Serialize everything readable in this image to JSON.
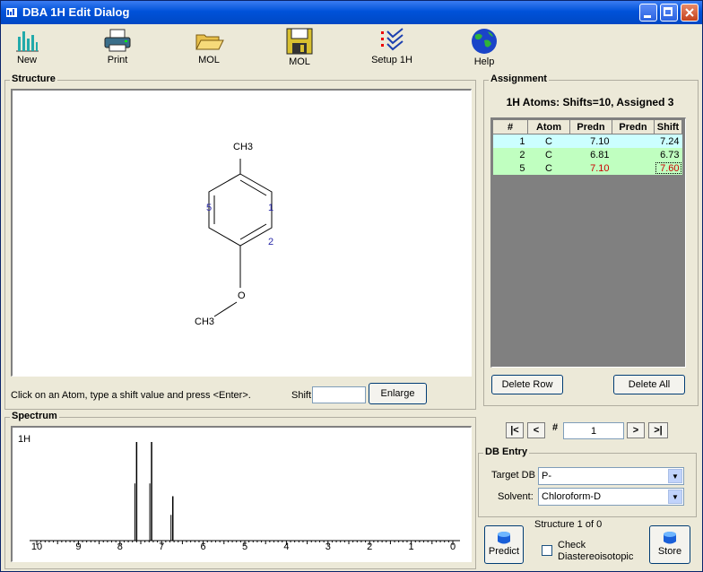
{
  "window": {
    "title": "DBA 1H Edit Dialog"
  },
  "toolbar": [
    {
      "label": "New",
      "icon": "bar-chart-icon"
    },
    {
      "label": "Print",
      "icon": "printer-icon"
    },
    {
      "label": "MOL",
      "icon": "open-folder-icon"
    },
    {
      "label": "MOL",
      "icon": "floppy-disk-icon"
    },
    {
      "label": "Setup 1H",
      "icon": "checklist-icon"
    },
    {
      "label": "Help",
      "icon": "globe-icon"
    }
  ],
  "structure": {
    "title": "Structure",
    "hint": "Click on an Atom, type a shift value and press <Enter>.",
    "shift_label": "Shift",
    "shift_value": "",
    "enlarge_label": "Enlarge",
    "molecule": {
      "top_group": "CH3",
      "bottom_group": "CH3",
      "oxygen": "O",
      "atom_numbers": [
        "5",
        "1",
        "2"
      ]
    }
  },
  "assignment": {
    "title": "Assignment",
    "summary": "1H Atoms: Shifts=10, Assigned 3",
    "columns": [
      "#",
      "Atom",
      "Predn",
      "Predn",
      "Shift"
    ],
    "rows": [
      {
        "num": "1",
        "atom": "C",
        "predn": "7.10",
        "predn2": "",
        "shift": "7.24"
      },
      {
        "num": "2",
        "atom": "C",
        "predn": "6.81",
        "predn2": "",
        "shift": "6.73"
      },
      {
        "num": "5",
        "atom": "C",
        "predn": "7.10",
        "predn2": "",
        "shift": "7.60"
      }
    ],
    "delete_row_label": "Delete Row",
    "delete_all_label": "Delete All"
  },
  "spectrum": {
    "title": "Spectrum",
    "nucleus": "1H",
    "axis_labels": [
      "10",
      "9",
      "8",
      "7",
      "6",
      "5",
      "4",
      "3",
      "2",
      "1",
      "0"
    ]
  },
  "chart_data": {
    "type": "bar",
    "x": [
      7.6,
      7.24,
      6.73
    ],
    "values": [
      1.0,
      1.0,
      0.45
    ],
    "xlim": [
      10,
      0
    ],
    "tick_labels": [
      "10",
      "9",
      "8",
      "7",
      "6",
      "5",
      "4",
      "3",
      "2",
      "1",
      "0"
    ],
    "title": "1H"
  },
  "nav": {
    "first": "|<",
    "prev": "<",
    "hash": "#",
    "record": "1",
    "next": ">",
    "last": ">|"
  },
  "db_entry": {
    "title": "DB Entry",
    "target_db_label": "Target DB",
    "target_db_value": "P-",
    "solvent_label": "Solvent:",
    "solvent_value": "Chloroform-D"
  },
  "footer": {
    "structure_status": "Structure 1 of 0",
    "predict_label": "Predict",
    "check_label": "Check",
    "check_label2": "Diastereoisotopic",
    "store_label": "Store"
  },
  "colors": {
    "title_bar": "#0052d9",
    "row1_bg": "#ccffff",
    "row_bg": "#c0ffc0",
    "grid_bg": "#808080",
    "mismatch": "#cc0000",
    "atom_number": "#2a2aa8"
  }
}
